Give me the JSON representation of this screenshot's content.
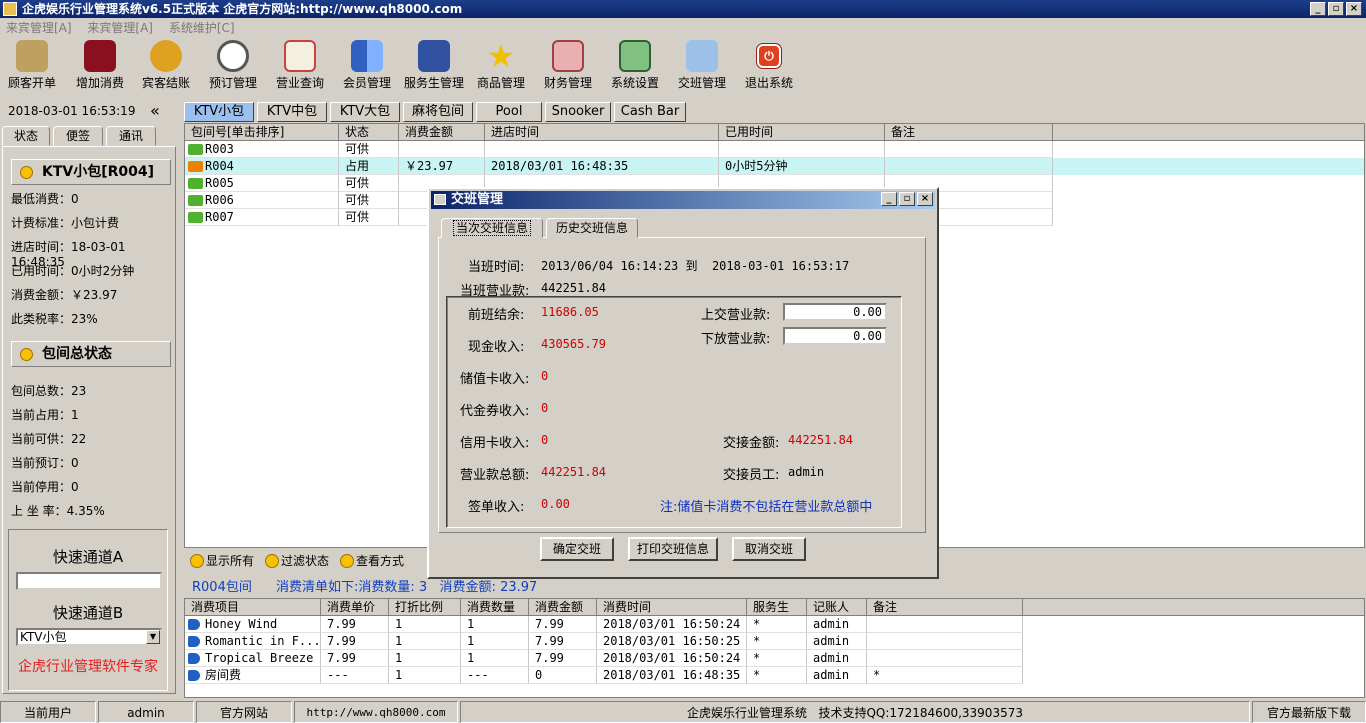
{
  "window": {
    "title": "企虎娱乐行业管理系统v6.5正式版本   企虎官方网站:http://www.qh8000.com",
    "min": "_",
    "max": "▫",
    "close": "×"
  },
  "menu": [
    "来宾管理[A]",
    "来宾管理[A]",
    "系统维护[C]"
  ],
  "toolbar": [
    {
      "label": "顾客开单",
      "icon": "key-icon",
      "color": "#c0a060"
    },
    {
      "label": "增加消费",
      "icon": "wine-icon",
      "color": "#8a1020"
    },
    {
      "label": "宾客结账",
      "icon": "coins-icon",
      "color": "#e0a020"
    },
    {
      "label": "预订管理",
      "icon": "alarm-clock-icon",
      "color": "#c8c8c8"
    },
    {
      "label": "营业查询",
      "icon": "document-icon",
      "color": "#d04040"
    },
    {
      "label": "会员管理",
      "icon": "finder-face-icon",
      "color": "#3060c0"
    },
    {
      "label": "服务生管理",
      "icon": "people-icon",
      "color": "#3050a0"
    },
    {
      "label": "商品管理",
      "icon": "star-icon",
      "color": "#f0c000"
    },
    {
      "label": "财务管理",
      "icon": "calculator-icon",
      "color": "#d06060"
    },
    {
      "label": "系统设置",
      "icon": "settings-icon",
      "color": "#40a040"
    },
    {
      "label": "交班管理",
      "icon": "handshake-icon",
      "color": "#4080c0"
    },
    {
      "label": "退出系统",
      "icon": "power-icon",
      "color": "#e04020"
    }
  ],
  "left": {
    "datetime": "2018-03-01 16:53:19",
    "collapse": "«",
    "tabs": [
      "状态",
      "便签",
      "通讯"
    ],
    "room_title": "KTV小包[R004]",
    "room_info": [
      "最低消费：0",
      "计费标准：小包计费",
      "进店时间：18-03-01 16:48:35",
      "已用时间：0小时2分钟",
      "消费金额：￥23.97",
      "此类税率：23%"
    ],
    "summary_title": "包间总状态",
    "summary": [
      "包间总数：23",
      "当前占用：1",
      "当前可供：22",
      "当前预订：0",
      "当前停用：0",
      "上 坐 率：4.35%"
    ],
    "quick_a": "快速通道A",
    "quick_b": "快速通道B",
    "quick_b_value": "KTV小包",
    "brand": "企虎行业管理软件专家"
  },
  "room_tabs": [
    "KTV小包",
    "KTV中包",
    "KTV大包",
    "麻将包间",
    "Pool",
    "Snooker",
    "Cash Bar"
  ],
  "rooms": {
    "headers": [
      "包间号[单击排序]",
      "状态",
      "消费金额",
      "进店时间",
      "已用时间",
      "备注"
    ],
    "rows": [
      {
        "id": "R003",
        "status": "可供",
        "amount": "",
        "time": "",
        "used": "",
        "note": "",
        "color": "#50b030"
      },
      {
        "id": "R004",
        "status": "占用",
        "amount": "￥23.97",
        "time": "2018/03/01 16:48:35",
        "used": "0小时5分钟",
        "note": "",
        "color": "#f08000"
      },
      {
        "id": "R005",
        "status": "可供",
        "amount": "",
        "time": "",
        "used": "",
        "note": "",
        "color": "#50b030"
      },
      {
        "id": "R006",
        "status": "可供",
        "amount": "",
        "time": "",
        "used": "",
        "note": "",
        "color": "#50b030"
      },
      {
        "id": "R007",
        "status": "可供",
        "amount": "",
        "time": "",
        "used": "",
        "note": "",
        "color": "#50b030"
      }
    ]
  },
  "filters": [
    "显示所有",
    "过滤状态",
    "查看方式"
  ],
  "consume_summary": {
    "room": "R004包间",
    "text": "消费清单如下:消费数量: 3   消费金额: 23.97"
  },
  "consume": {
    "headers": [
      "消费项目",
      "消费单价",
      "打折比例",
      "消费数量",
      "消费金额",
      "消费时间",
      "服务生",
      "记账人",
      "备注"
    ],
    "rows": [
      [
        "Honey Wind",
        "7.99",
        "1",
        "1",
        "7.99",
        "2018/03/01 16:50:24",
        "*",
        "admin",
        ""
      ],
      [
        "Romantic in F...",
        "7.99",
        "1",
        "1",
        "7.99",
        "2018/03/01 16:50:25",
        "*",
        "admin",
        ""
      ],
      [
        "Tropical Breeze",
        "7.99",
        "1",
        "1",
        "7.99",
        "2018/03/01 16:50:24",
        "*",
        "admin",
        ""
      ],
      [
        "房间费",
        "---",
        "1",
        "---",
        "0",
        "2018/03/01 16:48:35",
        "*",
        "admin",
        "*"
      ]
    ]
  },
  "dialog": {
    "title": "交班管理",
    "tabs": [
      "当次交班信息",
      "历史交班信息"
    ],
    "shift_time_label": "当班时间:",
    "shift_time": "2013/06/04 16:14:23 到  2018-03-01 16:53:17",
    "shift_revenue_label": "当班营业款:",
    "shift_revenue": "442251.84",
    "prev_balance_label": "前班结余:",
    "prev_balance": "11686.05",
    "cash_label": "现金收入:",
    "cash": "430565.79",
    "stored_card_label": "储值卡收入:",
    "stored_card": "0",
    "voucher_label": "代金券收入:",
    "voucher": "0",
    "credit_label": "信用卡收入:",
    "credit": "0",
    "total_label": "营业款总额:",
    "total": "442251.84",
    "sign_label": "签单收入:",
    "sign": "0.00",
    "hand_in_label": "上交营业款:",
    "hand_in": "0.00",
    "hand_down_label": "下放营业款:",
    "hand_down": "0.00",
    "handover_amount_label": "交接金额:",
    "handover_amount": "442251.84",
    "handover_staff_label": "交接员工:",
    "handover_staff": "admin",
    "note": "注:储值卡消费不包括在营业款总额中",
    "buttons": [
      "确定交班",
      "打印交班信息",
      "取消交班"
    ]
  },
  "status": {
    "user_label": "当前用户",
    "user": "admin",
    "site_label": "官方网站",
    "site": "http://www.qh8000.com",
    "system": "企虎娱乐行业管理系统   技术支持QQ:172184600,33903573",
    "download": "官方最新版下载"
  }
}
